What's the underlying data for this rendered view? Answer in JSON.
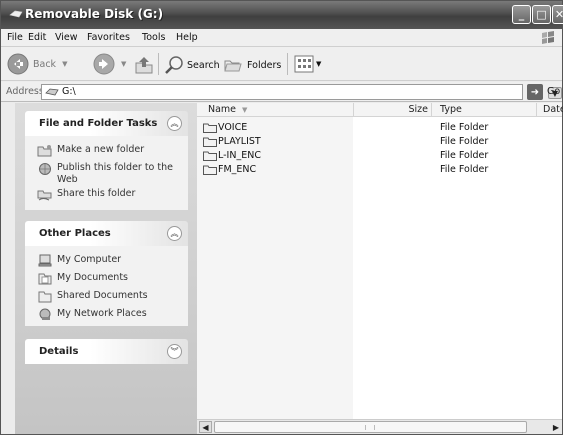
{
  "window": {
    "title": "Removable Disk (G:)",
    "controls": {
      "minimize": "_",
      "maximize": "□",
      "close": "✕"
    }
  },
  "menu": [
    "File",
    "Edit",
    "View",
    "Favorites",
    "Tools",
    "Help"
  ],
  "toolbar": {
    "back_label": "Back",
    "search_label": "Search",
    "folders_label": "Folders"
  },
  "address": {
    "label": "Address",
    "value": "G:\\",
    "go_label": "Go"
  },
  "tasks_panels": [
    {
      "title": "File and Folder Tasks",
      "chevron": "up",
      "items": [
        {
          "label": "Make a new folder",
          "icon": "new-folder-icon"
        },
        {
          "label": "Publish this folder to the Web",
          "icon": "publish-web-icon"
        },
        {
          "label": "Share this folder",
          "icon": "share-folder-icon"
        }
      ]
    },
    {
      "title": "Other Places",
      "chevron": "up",
      "items": [
        {
          "label": "My Computer",
          "icon": "my-computer-icon"
        },
        {
          "label": "My Documents",
          "icon": "my-documents-icon"
        },
        {
          "label": "Shared Documents",
          "icon": "shared-documents-icon"
        },
        {
          "label": "My Network Places",
          "icon": "network-places-icon"
        }
      ]
    },
    {
      "title": "Details",
      "chevron": "down",
      "items": []
    }
  ],
  "file_list": {
    "columns": [
      "Name",
      "Size",
      "Type",
      "Date"
    ],
    "rows": [
      {
        "name": "VOICE",
        "type": "File Folder"
      },
      {
        "name": "PLAYLIST",
        "type": "File Folder"
      },
      {
        "name": "L-IN_ENC",
        "type": "File Folder"
      },
      {
        "name": "FM_ENC",
        "type": "File Folder"
      }
    ]
  }
}
